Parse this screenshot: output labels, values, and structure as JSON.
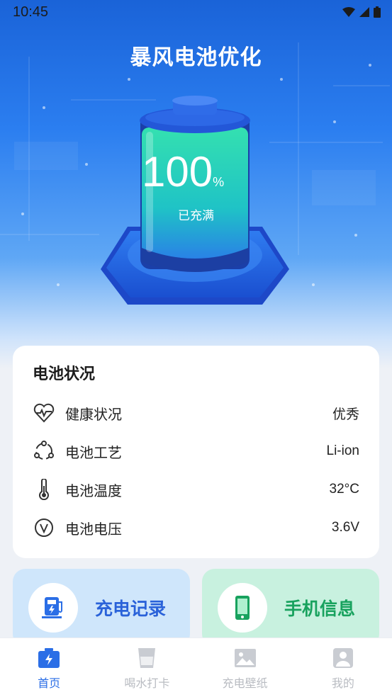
{
  "status_bar": {
    "time": "10:45"
  },
  "app": {
    "title": "暴风电池优化"
  },
  "battery": {
    "percent": "100",
    "percent_sign": "%",
    "status": "已充满",
    "level": 1.0
  },
  "card": {
    "title": "电池状况",
    "rows": [
      {
        "label": "健康状况",
        "value": "优秀",
        "icon": "heart-pulse-icon"
      },
      {
        "label": "电池工艺",
        "value": "Li-ion",
        "icon": "cycle-icon"
      },
      {
        "label": "电池温度",
        "value": "32°C",
        "icon": "thermometer-icon"
      },
      {
        "label": "电池电压",
        "value": "3.6V",
        "icon": "voltage-icon"
      }
    ]
  },
  "tiles": {
    "charge_record": "充电记录",
    "phone_info": "手机信息"
  },
  "tabs": [
    {
      "label": "首页",
      "active": true
    },
    {
      "label": "喝水打卡",
      "active": false
    },
    {
      "label": "充电壁纸",
      "active": false
    },
    {
      "label": "我的",
      "active": false
    }
  ],
  "colors": {
    "primary": "#2b6ee6",
    "green": "#18a25e",
    "battery_fill": "#2fd6a7"
  }
}
